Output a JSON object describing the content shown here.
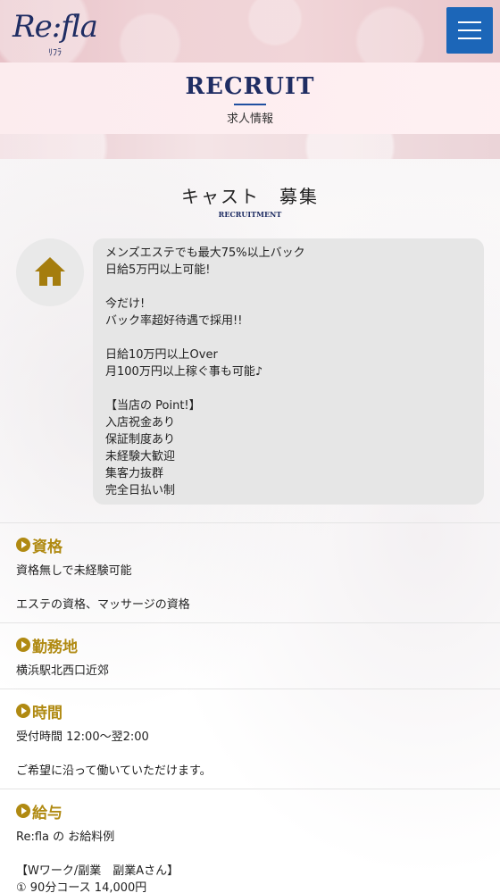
{
  "header": {
    "logo_text": "Re:fla",
    "logo_sub": "ﾘﾌﾗ",
    "menu_icon": "hamburger-menu-icon",
    "accent_color": "#1c66b8"
  },
  "page_title": {
    "en": "RECRUIT",
    "jp": "求人情報"
  },
  "recruit": {
    "title": "キャスト　募集",
    "subtitle": "RECRUITMENT",
    "avatar_icon": "home-icon",
    "message_lines": [
      "メンズエステでも最大75%以上バック",
      "日給5万円以上可能!",
      "",
      "今だけ!",
      "バック率超好待遇で採用!!",
      "",
      "日給10万円以上Over",
      "月100万円以上稼ぐ事も可能♪",
      "",
      "【当店の Point!】",
      "入店祝金あり",
      "保証制度あり",
      "未経験大歓迎",
      "集客力抜群",
      "完全日払い制"
    ]
  },
  "sections": [
    {
      "heading": "資格",
      "lines": [
        "資格無しで未経験可能",
        "",
        "エステの資格、マッサージの資格"
      ]
    },
    {
      "heading": "勤務地",
      "lines": [
        "横浜駅北西口近郊"
      ]
    },
    {
      "heading": "時間",
      "lines": [
        "受付時間 12:00～翌2:00",
        "",
        "ご希望に沿って働いていただけます。"
      ]
    },
    {
      "heading": "給与",
      "lines": [
        "Re:fla の お給料例",
        "",
        "【Wワーク/副業　副業Aさん】",
        "① 90分コース 14,000円"
      ]
    }
  ],
  "colors": {
    "heading_gold": "#b08a12",
    "title_navy": "#1f2d63"
  }
}
